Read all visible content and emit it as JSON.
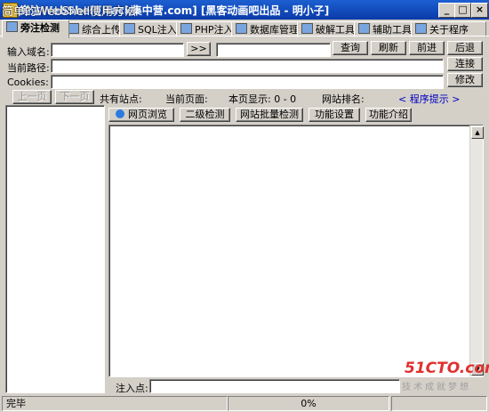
{
  "window": {
    "title": "旁注WebShell[Hack集中营.com]  [黑客动画吧出品 - 明小子]",
    "minimize": "_",
    "maximize": "□",
    "close": "×"
  },
  "overlay_caption": "简单的WebShell使用方法",
  "tabs": [
    "旁注检测",
    "综合上传",
    "SQL注入",
    "PHP注入",
    "数据库管理",
    "破解工具",
    "辅助工具",
    "关于程序"
  ],
  "form": {
    "domain_label": "输入域名:",
    "goto_btn": ">>",
    "query_btn": "查询",
    "refresh_btn": "刷新",
    "forward_btn": "前进",
    "back_btn": "后退",
    "path_label": "当前路径:",
    "connect_btn": "连接",
    "cookies_label": "Cookies:",
    "modify_btn": "修改"
  },
  "paging": {
    "prev_btn": "上一页",
    "next_btn": "下一页",
    "total_sites_label": "共有站点:",
    "current_page_label": "当前页面:",
    "page_display": "本页显示: 0 - 0",
    "rank_label": "网站排名:",
    "hint_link": "< 程序提示 >"
  },
  "subtabs": [
    "网页浏览",
    "二级检测",
    "网站批量检测",
    "功能设置",
    "功能介绍"
  ],
  "inject_label": "注入点:",
  "watermark": {
    "logo": "51CTO.com",
    "slogan": "技术成就梦想"
  },
  "status": {
    "text": "完毕",
    "progress": "0%"
  }
}
